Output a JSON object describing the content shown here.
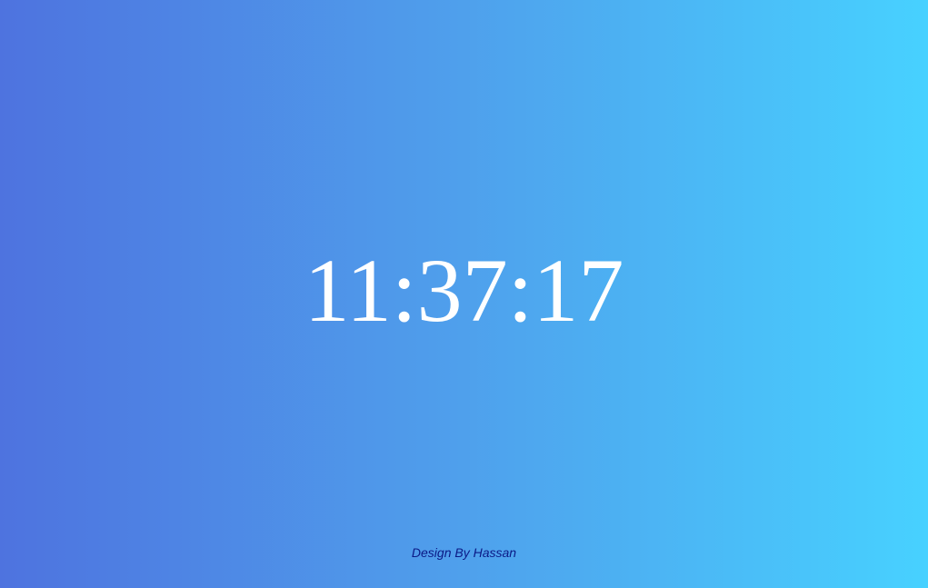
{
  "clock": {
    "time": "11:37:17"
  },
  "footer": {
    "credit": "Design By Hassan"
  },
  "colors": {
    "gradient_start": "#4e73df",
    "gradient_end": "#47d1ff",
    "time_text": "#ffffff",
    "credit_text": "#0b1a86"
  }
}
